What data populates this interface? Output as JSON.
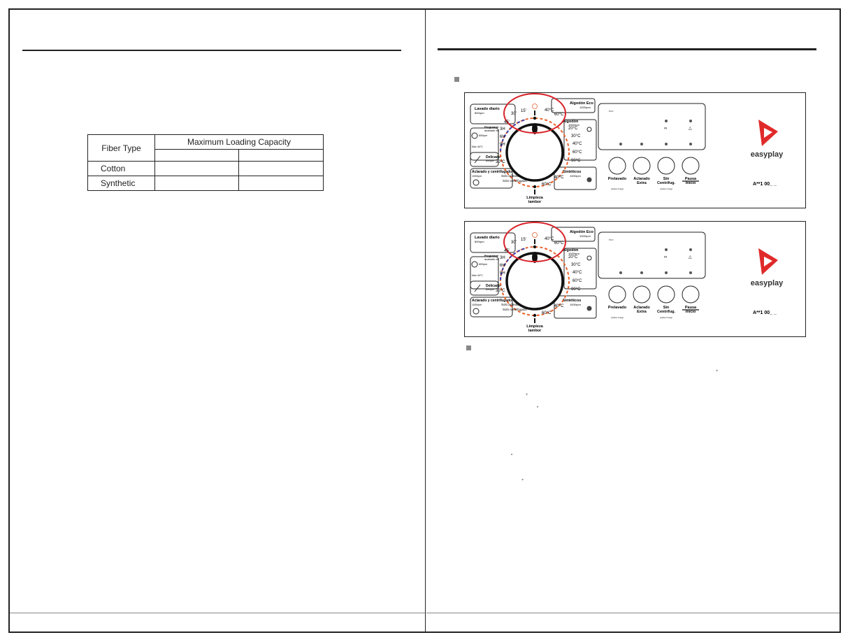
{
  "table": {
    "header_fiber": "Fiber Type",
    "header_capacity": "Maximum Loading Capacity",
    "subheaders": [
      "",
      ""
    ],
    "rows": [
      {
        "fiber": "Cotton",
        "values": [
          "",
          ""
        ]
      },
      {
        "fiber": "Synthetic",
        "values": [
          "",
          ""
        ]
      }
    ]
  },
  "panel": {
    "programs_left": [
      {
        "title": "Lavado diario",
        "sub": "800rpm"
      },
      {
        "title": "Programar acabado en",
        "sub": "800rpm",
        "extra": "Max 40°C",
        "icon": "clock-icon"
      },
      {
        "title": "Delicado",
        "sub": "600rpm",
        "icon": "feather-icon"
      },
      {
        "title": "Aclarado y centrifugado",
        "sub": "1000rpm",
        "icon": "rinse-spin-icon"
      }
    ],
    "programs_right": [
      {
        "title": "Algodón Eco",
        "sub": "1000rpm"
      },
      {
        "title": "Algodón",
        "sub": "1000rpm",
        "icon": "cotton-icon"
      },
      {
        "title": "Sintéticos",
        "sub": "1000rpm",
        "icon": "synthetic-icon"
      }
    ],
    "dial_left_labels": [
      "30'",
      "15'",
      "45'",
      "3H",
      "6H",
      "9H",
      "30°C"
    ],
    "dial_right_labels": [
      "40°C",
      "60°C",
      "20°C",
      "30°C",
      "40°C",
      "60°C",
      "90°C",
      "40°C",
      "60°C"
    ],
    "spin_only_labels": [
      "Solo aclarado",
      "Solo centrifugado"
    ],
    "bottom_label_1": "Limpieza",
    "bottom_label_2": "tambor",
    "display_eco_label": "eco",
    "buttons": [
      {
        "label1": "Prelavado",
        "label2": "",
        "sub": "(pulse 3 seg)"
      },
      {
        "label1": "Aclarado",
        "label2": "Extra",
        "sub": ""
      },
      {
        "label1": "Sin",
        "label2": "Centrifug.",
        "sub": "(pulse 3 seg)"
      },
      {
        "label1": "Pausa",
        "label2": "Inicio",
        "sub": ""
      }
    ],
    "brand": "easyplay",
    "model": "A**1  00_ _",
    "colors": {
      "highlight_ring": "#d8232a",
      "dial_orange": "#e8602a",
      "dial_blue": "#3a3aa8",
      "logo_red": "#e02a2a"
    }
  }
}
